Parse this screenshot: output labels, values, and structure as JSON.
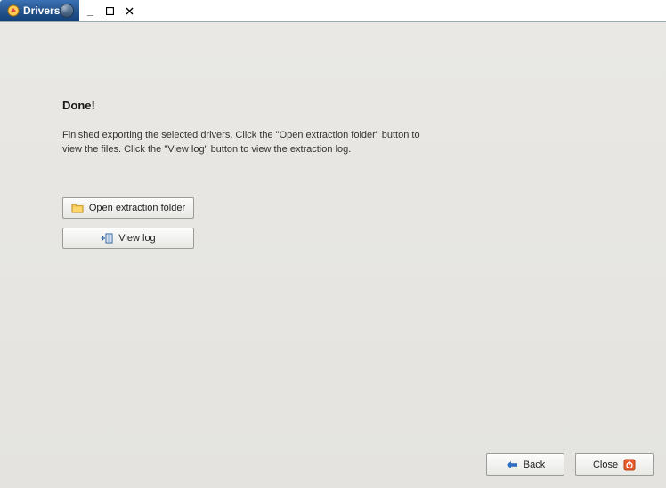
{
  "titlebar": {
    "title": "Drivers"
  },
  "window_controls": {
    "minimize": "–",
    "maximize": "▢",
    "close": "×"
  },
  "main": {
    "heading": "Done!",
    "body": "Finished exporting the selected drivers. Click the \"Open extraction folder\" button to view the files. Click the \"View log\" button to view the extraction log."
  },
  "buttons": {
    "open_folder": "Open extraction folder",
    "view_log": "View log",
    "back": "Back",
    "close": "Close"
  },
  "icons": {
    "app": "app-icon",
    "orb": "orb-icon",
    "folder": "folder-icon",
    "log": "log-icon",
    "back_arrow": "back-arrow-icon",
    "close_red": "close-power-icon"
  }
}
